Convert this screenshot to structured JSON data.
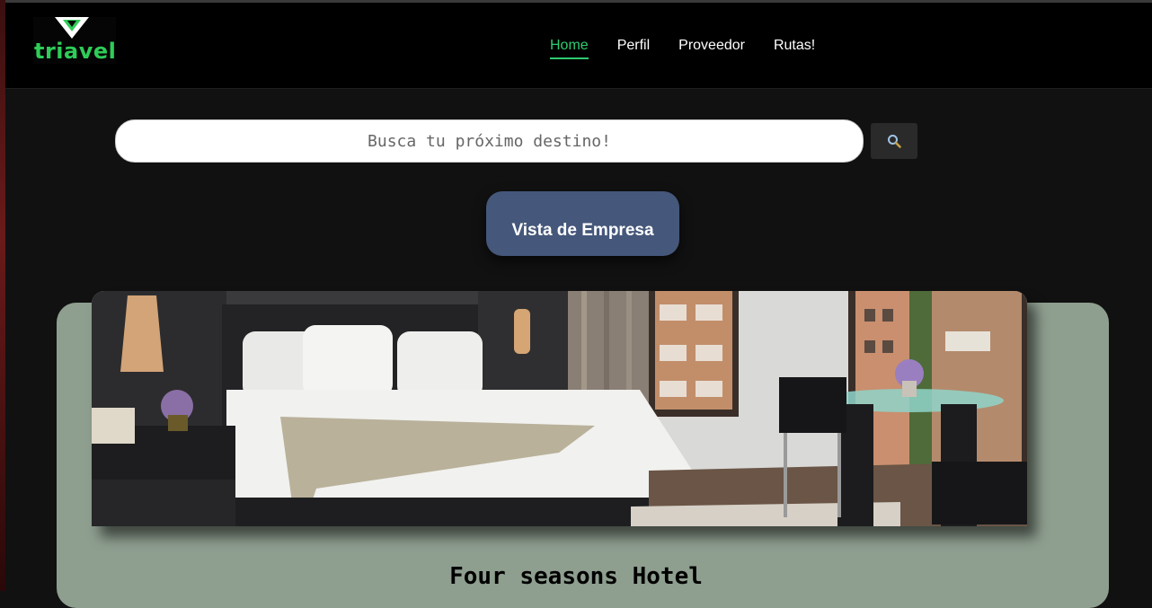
{
  "brand": {
    "name": "triavel",
    "color": "#2ecc58"
  },
  "nav": {
    "items": [
      {
        "label": "Home",
        "active": true
      },
      {
        "label": "Perfil",
        "active": false
      },
      {
        "label": "Proveedor",
        "active": false
      },
      {
        "label": "Rutas!",
        "active": false
      }
    ]
  },
  "search": {
    "placeholder": "Busca tu próximo destino!",
    "value": "",
    "button_icon": "search-icon"
  },
  "empresa_button": {
    "label": "Vista de Empresa",
    "color": "#45577a"
  },
  "hotel_card": {
    "title": "Four seasons Hotel",
    "image": "hotel-room-image",
    "background": "#8e9e8f"
  },
  "colors": {
    "accent": "#2ecc71",
    "page_bg": "#111111",
    "navbar_bg": "#000000"
  }
}
